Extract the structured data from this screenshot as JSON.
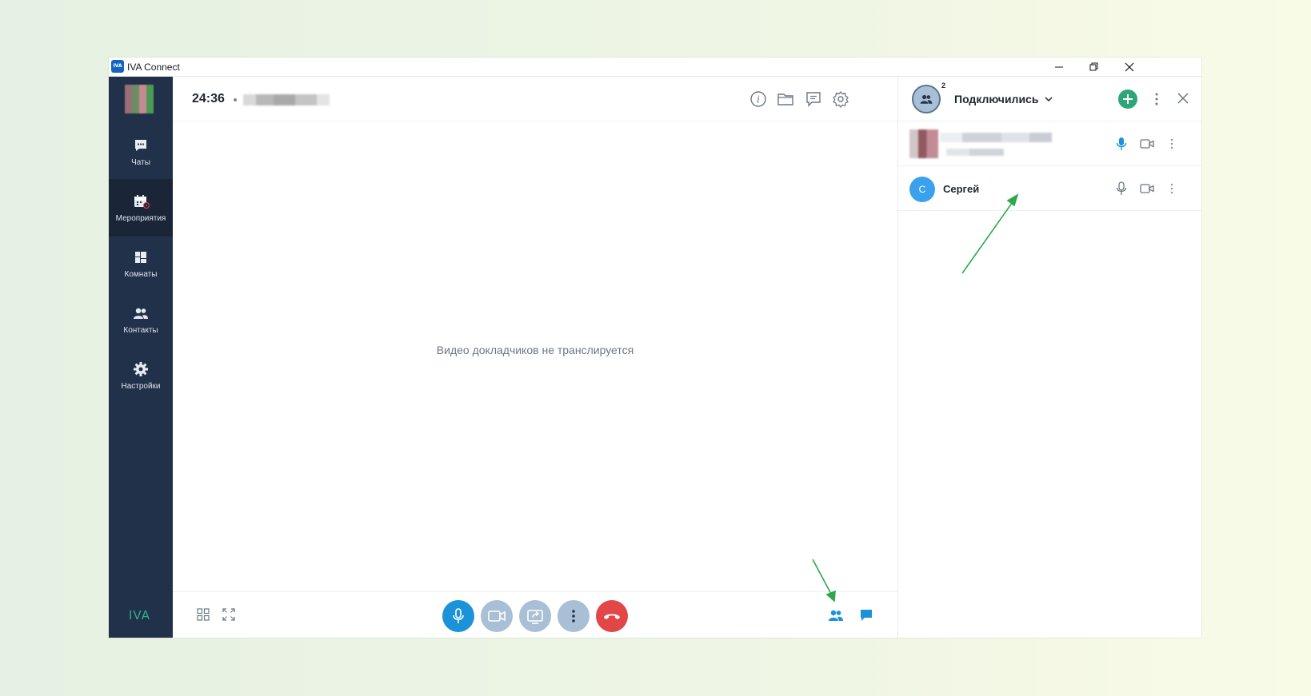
{
  "window": {
    "title": "IVA Connect",
    "logo_text": "IVA"
  },
  "sidebar": {
    "items": [
      {
        "label": "Чаты",
        "icon": "chat-icon"
      },
      {
        "label": "Мероприятия",
        "icon": "calendar-live-icon",
        "active": true
      },
      {
        "label": "Комнаты",
        "icon": "rooms-icon"
      },
      {
        "label": "Контакты",
        "icon": "contacts-icon"
      },
      {
        "label": "Настройки",
        "icon": "gear-icon"
      }
    ],
    "brand": "IVA"
  },
  "main": {
    "timer": "24:36",
    "empty_message": "Видео докладчиков не транслируется",
    "header_icons": [
      "info-icon",
      "folder-icon",
      "chat-list-icon",
      "settings-icon"
    ]
  },
  "controls": {
    "left": [
      "grid-layout-icon",
      "fullscreen-icon"
    ],
    "center": [
      "microphone-icon",
      "camera-icon",
      "share-screen-icon",
      "more-icon",
      "hang-up-icon"
    ],
    "right": [
      "participants-icon",
      "chat-icon"
    ]
  },
  "panel": {
    "title": "Подключились",
    "count": "2",
    "participants": [
      {
        "name": "",
        "mic": "active"
      },
      {
        "name": "Сергей",
        "initial": "С",
        "mic": "muted"
      }
    ]
  },
  "colors": {
    "sidebar": "#22314a",
    "accent_blue": "#1c93d8",
    "hang_up": "#e24646",
    "add_green": "#2fa67a",
    "annotation_arrow": "#2ea84f"
  }
}
